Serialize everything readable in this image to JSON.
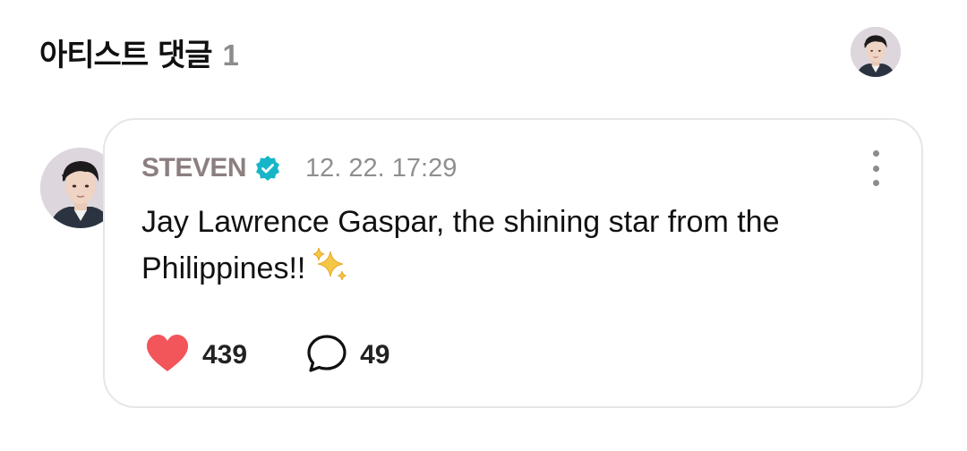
{
  "header": {
    "title": "아티스트 댓글",
    "count": "1"
  },
  "comment": {
    "author": "STEVEN",
    "verified": true,
    "timestamp": "12. 22. 17:29",
    "text": "Jay Lawrence Gaspar, the shining star from the Philippines!!",
    "emoji": "sparkles",
    "likes": "439",
    "replies": "49"
  },
  "icons": {
    "more": "more-vertical-icon",
    "like": "heart-icon",
    "reply": "speech-bubble-icon",
    "verified": "verified-badge-icon"
  },
  "colors": {
    "heart": "#f2555a",
    "verified": "#16b6c8",
    "author": "#8b7f80",
    "timestamp": "#8f8f8f",
    "card_border": "#e6e6ea"
  }
}
